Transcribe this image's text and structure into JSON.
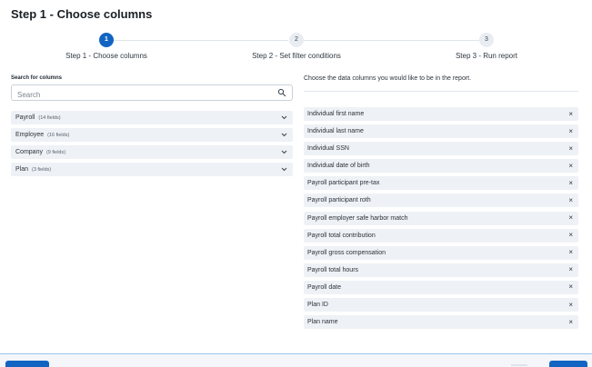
{
  "page": {
    "title": "Step 1 - Choose columns"
  },
  "stepper": {
    "steps": [
      {
        "number": "1",
        "label": "Step 1 - Choose columns",
        "state": "active"
      },
      {
        "number": "2",
        "label": "Step 2 - Set filter conditions",
        "state": "inactive"
      },
      {
        "number": "3",
        "label": "Step 3 - Run report",
        "state": "inactive"
      }
    ]
  },
  "search": {
    "label": "Search for columns",
    "placeholder": "Search",
    "value": ""
  },
  "groups": [
    {
      "name": "Payroll",
      "count": "(14 fields)"
    },
    {
      "name": "Employee",
      "count": "(16 fields)"
    },
    {
      "name": "Company",
      "count": "(9 fields)"
    },
    {
      "name": "Plan",
      "count": "(3 fields)"
    }
  ],
  "selection": {
    "instructions": "Choose the data columns you would like to be in the report.",
    "remove_glyph": "×",
    "items": [
      "Individual first name",
      "Individual last name",
      "Individual SSN",
      "Individual date of birth",
      "Payroll participant pre-tax",
      "Payroll participant roth",
      "Payroll employer safe harbor match",
      "Payroll total contribution",
      "Payroll gross compensation",
      "Payroll total hours",
      "Payroll date",
      "Plan ID",
      "Plan name"
    ]
  },
  "colors": {
    "accent": "#1264c2",
    "chip": "#eef1f5",
    "border": "#c9d1da"
  },
  "icons": {
    "search": "search-icon",
    "expand": "chevron-down-icon",
    "remove": "close-icon"
  }
}
